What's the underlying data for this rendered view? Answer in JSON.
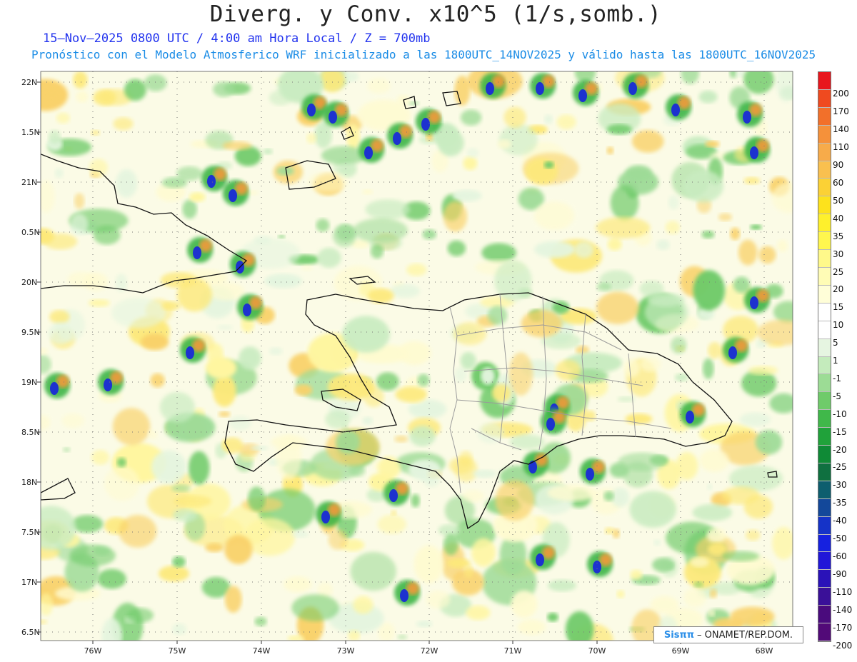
{
  "title": "Diverg. y Conv. x10^5 (1/s,somb.)",
  "subtitle_time": "15–Nov–2025  0800 UTC / 4:00 am Hora Local / Z = 700mb",
  "subtitle_model": "Pronóstico con el Modelo Atmosferico WRF inicializado a las 1800UTC_14NOV2025 y válido hasta las  1800UTC_16NOV2025",
  "lat_labels": [
    "22N",
    "1.5N",
    "21N",
    "0.5N",
    "20N",
    "9.5N",
    "19N",
    "8.5N",
    "18N",
    "7.5N",
    "17N",
    "6.5N"
  ],
  "lon_labels": [
    "76W",
    "75W",
    "74W",
    "73W",
    "72W",
    "71W",
    "70W",
    "69W",
    "68W"
  ],
  "colorbar": {
    "labels": [
      "200",
      "170",
      "140",
      "110",
      "90",
      "60",
      "50",
      "40",
      "35",
      "30",
      "25",
      "20",
      "15",
      "10",
      "5",
      "1",
      "-1",
      "-5",
      "-10",
      "-15",
      "-20",
      "-25",
      "-30",
      "-35",
      "-40",
      "-50",
      "-60",
      "-90",
      "-110",
      "-140",
      "-170",
      "-200"
    ],
    "colors": [
      "#e8161d",
      "#ef4a1f",
      "#f2702a",
      "#f5913a",
      "#f7ab4a",
      "#f9c04f",
      "#fbd135",
      "#fde21c",
      "#fef02c",
      "#fff64e",
      "#fff98a",
      "#fffcb6",
      "#fffed8",
      "#ffffff",
      "#ffffff",
      "#e6f5e1",
      "#c4ebbc",
      "#9cdc95",
      "#6fcb6a",
      "#40b84a",
      "#20a23a",
      "#0f8a36",
      "#0f7040",
      "#0e5e6e",
      "#13489a",
      "#1533c8",
      "#1621e0",
      "#2117d8",
      "#2a12b8",
      "#3a1098",
      "#4a0b7d",
      "#520a78"
    ]
  },
  "credit": {
    "logo": "Sisππ",
    "text": "– ONAMET/REP.DOM."
  }
}
